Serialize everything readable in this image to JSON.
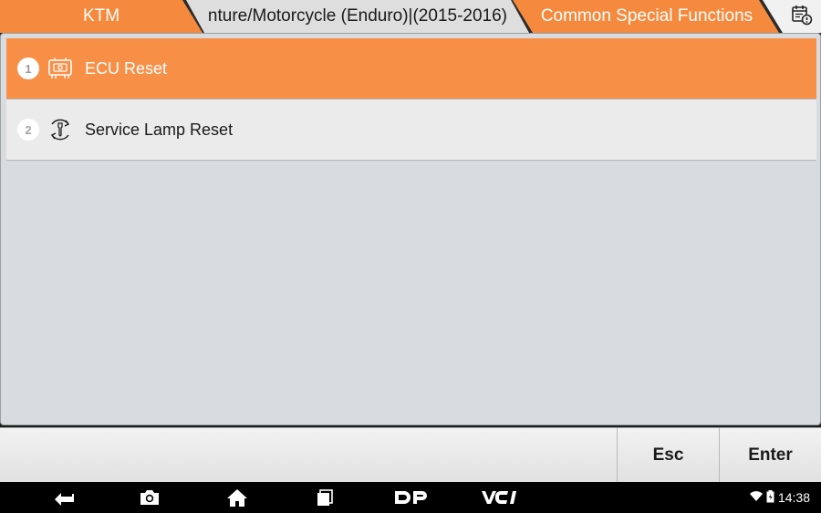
{
  "breadcrumb": {
    "brand": "KTM",
    "model": "nture/Motorcycle (Enduro)|(2015-2016)",
    "current": "Common Special Functions"
  },
  "toolbar": {
    "calendar_icon": "calendar-info-icon"
  },
  "functions": [
    {
      "number": "1",
      "label": "ECU Reset",
      "icon": "ecu-icon",
      "selected": true
    },
    {
      "number": "2",
      "label": "Service Lamp Reset",
      "icon": "wrench-reset-icon",
      "selected": false
    }
  ],
  "actions": {
    "esc_label": "Esc",
    "enter_label": "Enter"
  },
  "nav": {
    "back_icon": "back-arrow-icon",
    "screenshot_icon": "camera-icon",
    "home_icon": "home-icon",
    "recents_icon": "recent-apps-icon",
    "dp_label": "DP",
    "vci_label": "VCI"
  },
  "status": {
    "time": "14:38"
  },
  "colors": {
    "accent": "#f88f47",
    "crumb_orange": "#f58a3e"
  }
}
